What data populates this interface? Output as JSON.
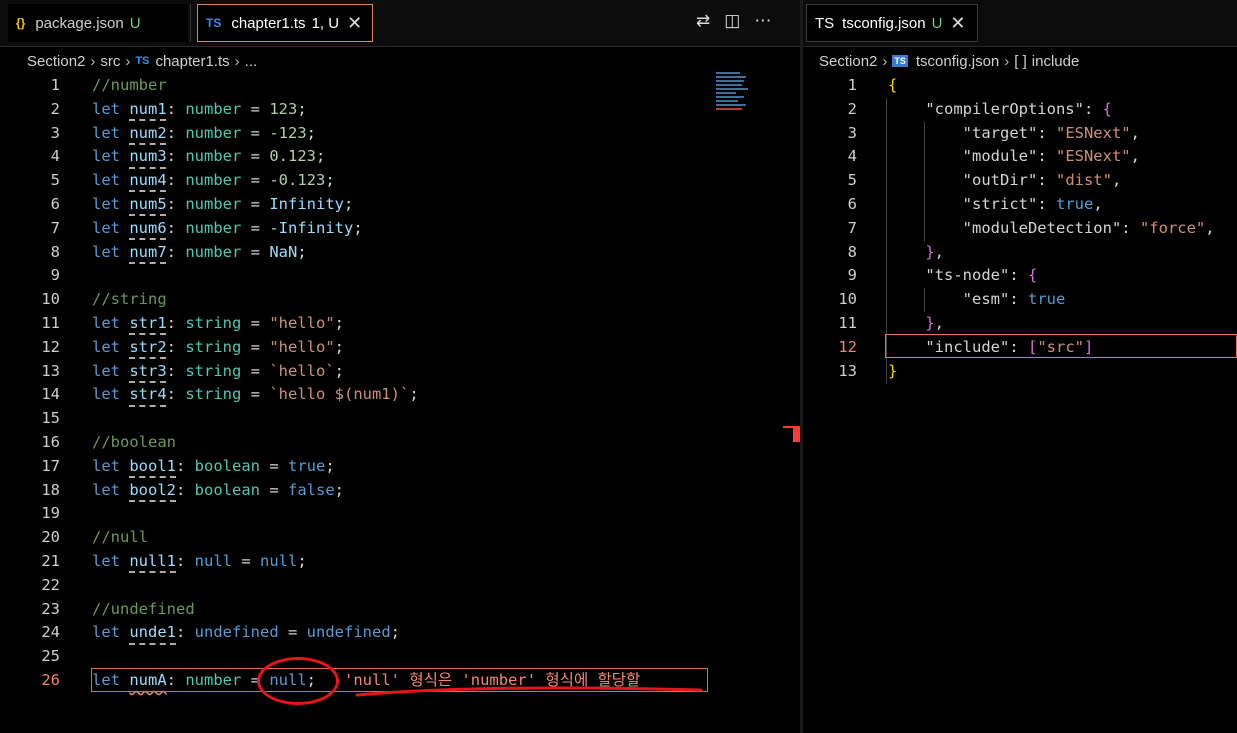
{
  "left_tabs": [
    {
      "icon": "{}",
      "label": "package.json",
      "status": "U",
      "active": false
    },
    {
      "icon": "TS",
      "label": "chapter1.ts",
      "status": "1, U",
      "active": true
    }
  ],
  "right_tab": {
    "icon": "TS",
    "label": "tsconfig.json",
    "status": "U"
  },
  "left_breadcrumb": [
    "Section2",
    "src",
    "chapter1.ts",
    "..."
  ],
  "right_breadcrumb": [
    "Section2",
    "tsconfig.json",
    "include"
  ],
  "left_lines": [
    {
      "n": "1",
      "tokens": [
        [
          "c",
          "//number"
        ]
      ]
    },
    {
      "n": "2",
      "tokens": [
        [
          "k",
          "let "
        ],
        [
          "v u",
          "num1"
        ],
        [
          "p",
          ": "
        ],
        [
          "t",
          "number"
        ],
        [
          "p",
          " = "
        ],
        [
          "n",
          "123"
        ],
        [
          "p",
          ";"
        ]
      ]
    },
    {
      "n": "3",
      "tokens": [
        [
          "k",
          "let "
        ],
        [
          "v u",
          "num2"
        ],
        [
          "p",
          ": "
        ],
        [
          "t",
          "number"
        ],
        [
          "p",
          " = "
        ],
        [
          "n",
          "-123"
        ],
        [
          "p",
          ";"
        ]
      ]
    },
    {
      "n": "4",
      "tokens": [
        [
          "k",
          "let "
        ],
        [
          "v u",
          "num3"
        ],
        [
          "p",
          ": "
        ],
        [
          "t",
          "number"
        ],
        [
          "p",
          " = "
        ],
        [
          "n",
          "0.123"
        ],
        [
          "p",
          ";"
        ]
      ]
    },
    {
      "n": "5",
      "tokens": [
        [
          "k",
          "let "
        ],
        [
          "v u",
          "num4"
        ],
        [
          "p",
          ": "
        ],
        [
          "t",
          "number"
        ],
        [
          "p",
          " = "
        ],
        [
          "n",
          "-0.123"
        ],
        [
          "p",
          ";"
        ]
      ]
    },
    {
      "n": "6",
      "tokens": [
        [
          "k",
          "let "
        ],
        [
          "v u",
          "num5"
        ],
        [
          "p",
          ": "
        ],
        [
          "t",
          "number"
        ],
        [
          "p",
          " = "
        ],
        [
          "v",
          "Infinity"
        ],
        [
          "p",
          ";"
        ]
      ]
    },
    {
      "n": "7",
      "tokens": [
        [
          "k",
          "let "
        ],
        [
          "v u",
          "num6"
        ],
        [
          "p",
          ": "
        ],
        [
          "t",
          "number"
        ],
        [
          "p",
          " = "
        ],
        [
          "v",
          "-Infinity"
        ],
        [
          "p",
          ";"
        ]
      ]
    },
    {
      "n": "8",
      "tokens": [
        [
          "k",
          "let "
        ],
        [
          "v u",
          "num7"
        ],
        [
          "p",
          ": "
        ],
        [
          "t",
          "number"
        ],
        [
          "p",
          " = "
        ],
        [
          "v",
          "NaN"
        ],
        [
          "p",
          ";"
        ]
      ]
    },
    {
      "n": "9",
      "tokens": []
    },
    {
      "n": "10",
      "tokens": [
        [
          "c",
          "//string"
        ]
      ]
    },
    {
      "n": "11",
      "tokens": [
        [
          "k",
          "let "
        ],
        [
          "v u",
          "str1"
        ],
        [
          "p",
          ": "
        ],
        [
          "t",
          "string"
        ],
        [
          "p",
          " = "
        ],
        [
          "s",
          "\"hello\""
        ],
        [
          "p",
          ";"
        ]
      ]
    },
    {
      "n": "12",
      "tokens": [
        [
          "k",
          "let "
        ],
        [
          "v u",
          "str2"
        ],
        [
          "p",
          ": "
        ],
        [
          "t",
          "string"
        ],
        [
          "p",
          " = "
        ],
        [
          "s",
          "\"hello\""
        ],
        [
          "p",
          ";"
        ]
      ]
    },
    {
      "n": "13",
      "tokens": [
        [
          "k",
          "let "
        ],
        [
          "v u",
          "str3"
        ],
        [
          "p",
          ": "
        ],
        [
          "t",
          "string"
        ],
        [
          "p",
          " = "
        ],
        [
          "s",
          "`hello`"
        ],
        [
          "p",
          ";"
        ]
      ]
    },
    {
      "n": "14",
      "tokens": [
        [
          "k",
          "let "
        ],
        [
          "v u",
          "str4"
        ],
        [
          "p",
          ": "
        ],
        [
          "t",
          "string"
        ],
        [
          "p",
          " = "
        ],
        [
          "s",
          "`hello $(num1)`"
        ],
        [
          "p",
          ";"
        ]
      ]
    },
    {
      "n": "15",
      "tokens": []
    },
    {
      "n": "16",
      "tokens": [
        [
          "c",
          "//boolean"
        ]
      ]
    },
    {
      "n": "17",
      "tokens": [
        [
          "k",
          "let "
        ],
        [
          "v u",
          "bool1"
        ],
        [
          "p",
          ": "
        ],
        [
          "t",
          "boolean"
        ],
        [
          "p",
          " = "
        ],
        [
          "k",
          "true"
        ],
        [
          "p",
          ";"
        ]
      ]
    },
    {
      "n": "18",
      "tokens": [
        [
          "k",
          "let "
        ],
        [
          "v u",
          "bool2"
        ],
        [
          "p",
          ": "
        ],
        [
          "t",
          "boolean"
        ],
        [
          "p",
          " = "
        ],
        [
          "k",
          "false"
        ],
        [
          "p",
          ";"
        ]
      ]
    },
    {
      "n": "19",
      "tokens": []
    },
    {
      "n": "20",
      "tokens": [
        [
          "c",
          "//null"
        ]
      ]
    },
    {
      "n": "21",
      "tokens": [
        [
          "k",
          "let "
        ],
        [
          "v u",
          "null1"
        ],
        [
          "p",
          ": "
        ],
        [
          "k",
          "null"
        ],
        [
          "p",
          " = "
        ],
        [
          "k",
          "null"
        ],
        [
          "p",
          ";"
        ]
      ]
    },
    {
      "n": "22",
      "tokens": []
    },
    {
      "n": "23",
      "tokens": [
        [
          "c",
          "//undefined"
        ]
      ]
    },
    {
      "n": "24",
      "tokens": [
        [
          "k",
          "let "
        ],
        [
          "v u",
          "unde1"
        ],
        [
          "p",
          ": "
        ],
        [
          "k",
          "undefined"
        ],
        [
          "p",
          " = "
        ],
        [
          "k",
          "undefined"
        ],
        [
          "p",
          ";"
        ]
      ]
    },
    {
      "n": "25",
      "tokens": []
    },
    {
      "n": "26",
      "current": true,
      "tokens": [
        [
          "k",
          "let "
        ],
        [
          "v e",
          "numA"
        ],
        [
          "p",
          ": "
        ],
        [
          "t",
          "number"
        ],
        [
          "p",
          " = "
        ],
        [
          "k",
          "null"
        ],
        [
          "p",
          ";"
        ],
        [
          "p",
          "   "
        ],
        [
          "errmsg",
          "'null' 형식은 'number' 형식에 할당할"
        ]
      ]
    }
  ],
  "right_lines": [
    {
      "n": "1",
      "tokens": [
        [
          "bry",
          "{"
        ]
      ]
    },
    {
      "n": "2",
      "tokens": [
        [
          "p",
          "    "
        ],
        [
          "key",
          "\"compilerOptions\""
        ],
        [
          "p",
          ": "
        ],
        [
          "br",
          "{"
        ]
      ]
    },
    {
      "n": "3",
      "tokens": [
        [
          "p",
          "        "
        ],
        [
          "key",
          "\"target\""
        ],
        [
          "p",
          ": "
        ],
        [
          "s",
          "\"ESNext\""
        ],
        [
          "p",
          ","
        ]
      ]
    },
    {
      "n": "4",
      "tokens": [
        [
          "p",
          "        "
        ],
        [
          "key",
          "\"module\""
        ],
        [
          "p",
          ": "
        ],
        [
          "s",
          "\"ESNext\""
        ],
        [
          "p",
          ","
        ]
      ]
    },
    {
      "n": "5",
      "tokens": [
        [
          "p",
          "        "
        ],
        [
          "key",
          "\"outDir\""
        ],
        [
          "p",
          ": "
        ],
        [
          "s",
          "\"dist\""
        ],
        [
          "p",
          ","
        ]
      ]
    },
    {
      "n": "6",
      "tokens": [
        [
          "p",
          "        "
        ],
        [
          "key",
          "\"strict\""
        ],
        [
          "p",
          ": "
        ],
        [
          "k",
          "true"
        ],
        [
          "p",
          ","
        ]
      ]
    },
    {
      "n": "7",
      "tokens": [
        [
          "p",
          "        "
        ],
        [
          "key",
          "\"moduleDetection\""
        ],
        [
          "p",
          ": "
        ],
        [
          "s",
          "\"force\""
        ],
        [
          "p",
          ","
        ]
      ]
    },
    {
      "n": "8",
      "tokens": [
        [
          "p",
          "    "
        ],
        [
          "br",
          "}"
        ],
        [
          "p",
          ","
        ]
      ]
    },
    {
      "n": "9",
      "tokens": [
        [
          "p",
          "    "
        ],
        [
          "key",
          "\"ts-node\""
        ],
        [
          "p",
          ": "
        ],
        [
          "br",
          "{"
        ]
      ]
    },
    {
      "n": "10",
      "tokens": [
        [
          "p",
          "        "
        ],
        [
          "key",
          "\"esm\""
        ],
        [
          "p",
          ": "
        ],
        [
          "k",
          "true"
        ]
      ]
    },
    {
      "n": "11",
      "tokens": [
        [
          "p",
          "    "
        ],
        [
          "br",
          "}"
        ],
        [
          "p",
          ","
        ]
      ]
    },
    {
      "n": "12",
      "current": true,
      "tokens": [
        [
          "p",
          "    "
        ],
        [
          "key",
          "\"include\""
        ],
        [
          "p",
          ": "
        ],
        [
          "br",
          "["
        ],
        [
          "s",
          "\"src\""
        ],
        [
          "br",
          "]"
        ]
      ]
    },
    {
      "n": "13",
      "tokens": [
        [
          "bry",
          "}"
        ]
      ]
    }
  ],
  "colors": {
    "accent": "#d7875f",
    "error": "#f48771",
    "annotation": "#e8141a"
  }
}
